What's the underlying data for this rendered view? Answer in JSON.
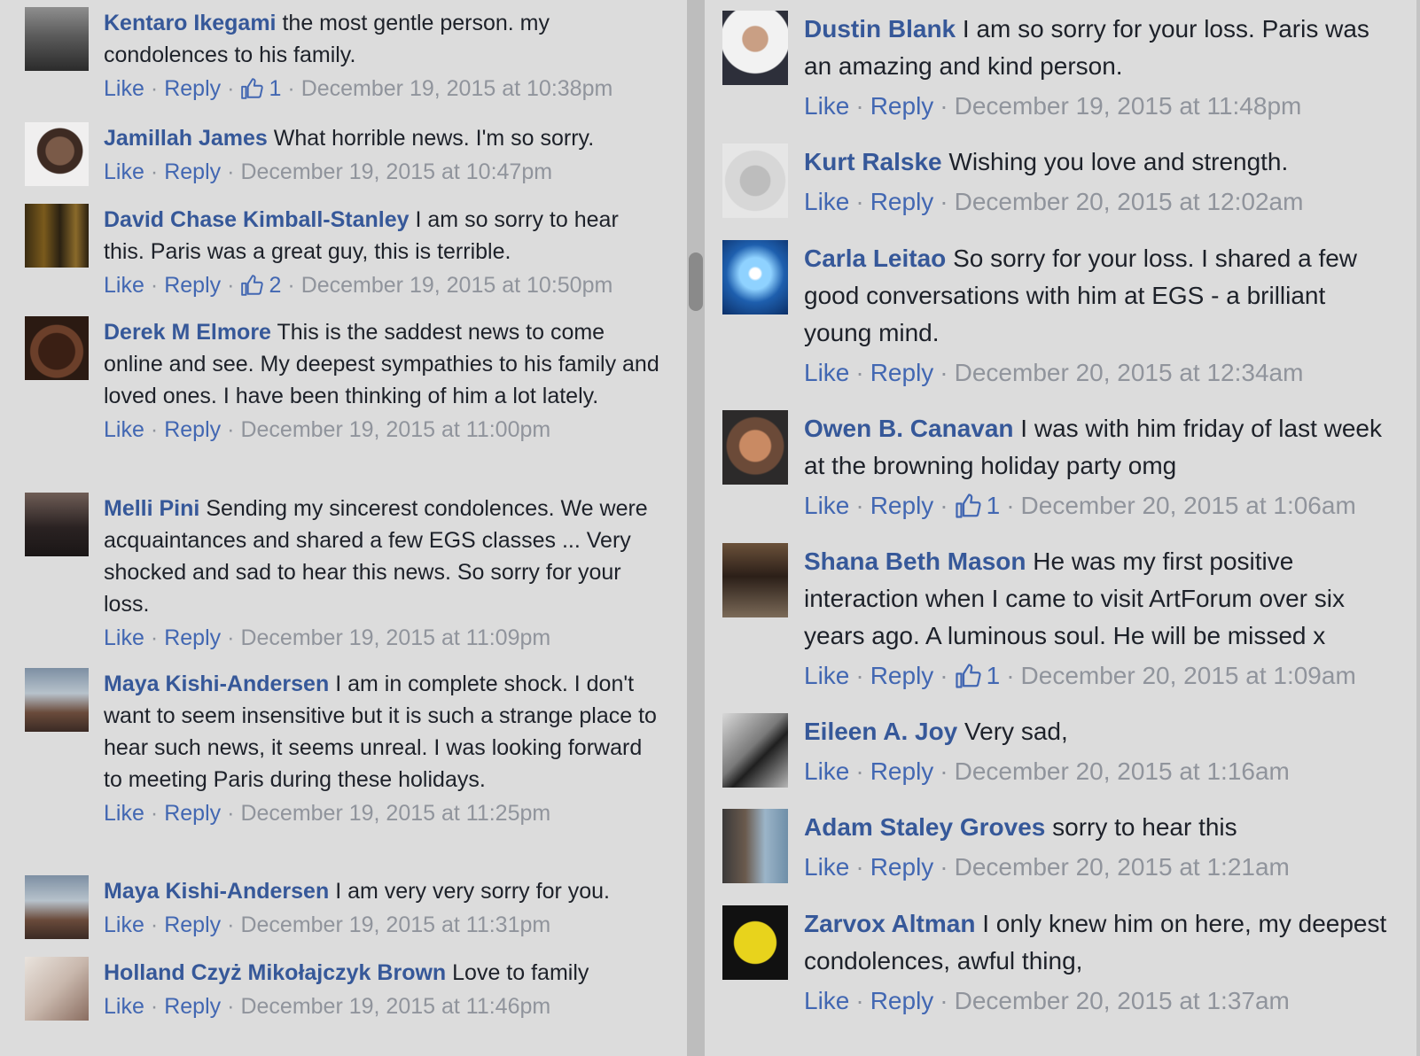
{
  "actions": {
    "like": "Like",
    "reply": "Reply",
    "sep": "·"
  },
  "left_comments": [
    {
      "author": "Kentaro Ikegami",
      "text": "the most gentle person. my condolences to his family.",
      "likes": "1",
      "date": "December 19, 2015 at 10:38pm",
      "avatar": "person-in-suit"
    },
    {
      "author": "Jamillah James",
      "text": "What horrible news. I'm so sorry.",
      "likes": null,
      "date": "December 19, 2015 at 10:47pm",
      "avatar": "sleeping-face"
    },
    {
      "author": "David Chase Kimball-Stanley",
      "text": "I am so sorry to hear this. Paris was a great guy, this is terrible.",
      "likes": "2",
      "date": "December 19, 2015 at 10:50pm",
      "avatar": "group-photo"
    },
    {
      "author": "Derek M Elmore",
      "text": "This is the saddest news to come online and see. My deepest sympathies to his family and loved ones. I have been thinking of him a lot lately.",
      "likes": null,
      "date": "December 19, 2015 at 11:00pm",
      "avatar": "circle-pattern"
    },
    {
      "author": "Melli Pini",
      "text": "Sending my sincerest condolences. We were acquaintances and shared a few EGS classes ... Very shocked and sad to hear this news. So sorry for your loss.",
      "likes": null,
      "date": "December 19, 2015 at 11:09pm",
      "avatar": "woman-dark-dress"
    },
    {
      "author": "Maya Kishi-Andersen",
      "text": "I am in complete shock. I don't want to seem insensitive but it is such a strange place to hear such news, it seems unreal. I was looking forward to meeting Paris during these holidays.",
      "likes": null,
      "date": "December 19, 2015 at 11:25pm",
      "avatar": "woman-beach"
    },
    {
      "author": "Maya Kishi-Andersen",
      "text": "I am very very sorry for you.",
      "likes": null,
      "date": "December 19, 2015 at 11:31pm",
      "avatar": "woman-beach"
    },
    {
      "author": "Holland Czyż Mikołajczyk Brown",
      "text": "Love to family",
      "likes": null,
      "date": "December 19, 2015 at 11:46pm",
      "avatar": "woman-white-shirt"
    }
  ],
  "right_comments": [
    {
      "author": "Dustin Blank",
      "text": "I am so sorry for your loss. Paris was an amazing and kind person.",
      "likes": null,
      "date": "December 19, 2015 at 11:48pm",
      "avatar": "man-in-suit"
    },
    {
      "author": "Kurt Ralske",
      "text": "Wishing you love and strength.",
      "likes": null,
      "date": "December 20, 2015 at 12:02am",
      "avatar": "faded-face"
    },
    {
      "author": "Carla Leitao",
      "text": "So sorry for your loss. I shared a few good conversations with him at EGS - a brilliant young mind.",
      "likes": null,
      "date": "December 20, 2015 at 12:34am",
      "avatar": "blue-burst"
    },
    {
      "author": "Owen B. Canavan",
      "text": "I was with him friday of last week at the browning holiday party omg",
      "likes": "1",
      "date": "December 20, 2015 at 1:06am",
      "avatar": "smiling-man"
    },
    {
      "author": "Shana Beth Mason",
      "text": "He was my first positive interaction when I came to visit ArtForum over six years ago. A luminous soul. He will be missed x",
      "likes": "1",
      "date": "December 20, 2015 at 1:09am",
      "avatar": "seated-woman"
    },
    {
      "author": "Eileen A. Joy",
      "text": "Very sad,",
      "likes": null,
      "date": "December 20, 2015 at 1:16am",
      "avatar": "dancer-bw"
    },
    {
      "author": "Adam Staley Groves",
      "text": "sorry to hear this",
      "likes": null,
      "date": "December 20, 2015 at 1:21am",
      "avatar": "couple-selfie"
    },
    {
      "author": "Zarvox Altman",
      "text": "I only knew him on here, my deepest condolences, awful thing,",
      "likes": null,
      "date": "December 20, 2015 at 1:37am",
      "avatar": "yellow-bat-logo"
    }
  ]
}
